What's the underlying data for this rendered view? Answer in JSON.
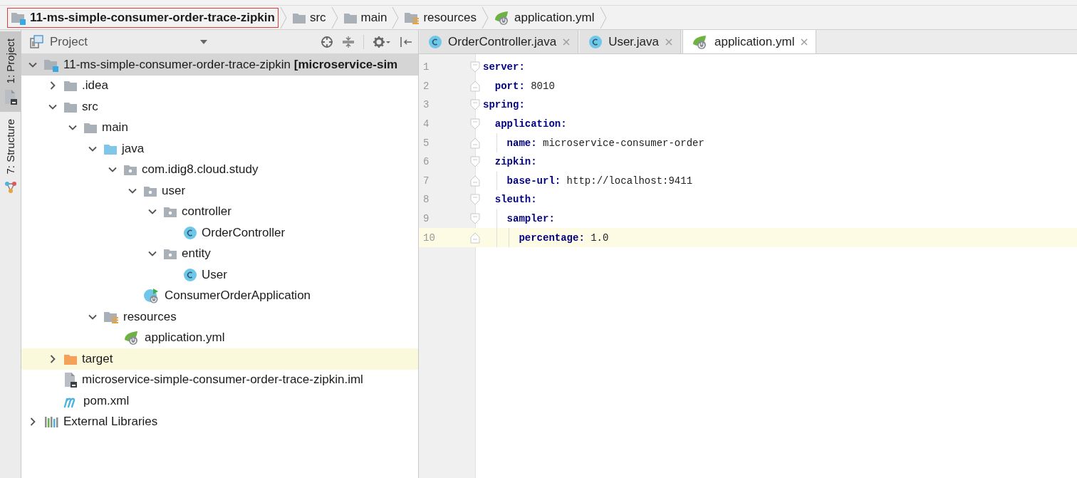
{
  "breadcrumbs": [
    {
      "label": "11-ms-simple-consumer-order-trace-zipkin",
      "kind": "project",
      "outlined": true
    },
    {
      "label": "src",
      "kind": "folder",
      "outlined": false
    },
    {
      "label": "main",
      "kind": "folder",
      "outlined": false
    },
    {
      "label": "resources",
      "kind": "resources",
      "outlined": false
    },
    {
      "label": "application.yml",
      "kind": "yml",
      "outlined": false
    }
  ],
  "tool_stripe": [
    {
      "label": "1: Project",
      "kind": "project",
      "selected": true
    },
    {
      "label": "7: Structure",
      "kind": "structure",
      "selected": false
    }
  ],
  "project_panel": {
    "title": "Project",
    "tree": [
      {
        "label": "11-ms-simple-consumer-order-trace-zipkin **[microservice-sim**",
        "kind": "module",
        "expanded": true,
        "selected": true,
        "highlighted": false,
        "children": [
          {
            "label": ".idea",
            "kind": "folder",
            "expanded": false,
            "selected": false,
            "highlighted": false
          },
          {
            "label": "src",
            "kind": "folder",
            "expanded": true,
            "selected": false,
            "highlighted": false,
            "children": [
              {
                "label": "main",
                "kind": "folder",
                "expanded": true,
                "selected": false,
                "highlighted": false,
                "children": [
                  {
                    "label": "java",
                    "kind": "source",
                    "expanded": true,
                    "selected": false,
                    "highlighted": false,
                    "children": [
                      {
                        "label": "com.idig8.cloud.study",
                        "kind": "package",
                        "expanded": true,
                        "selected": false,
                        "highlighted": false,
                        "children": [
                          {
                            "label": "user",
                            "kind": "package",
                            "expanded": true,
                            "selected": false,
                            "highlighted": false,
                            "children": [
                              {
                                "label": "controller",
                                "kind": "package",
                                "expanded": true,
                                "selected": false,
                                "highlighted": false,
                                "children": [
                                  {
                                    "label": "OrderController",
                                    "kind": "class",
                                    "selected": false,
                                    "highlighted": false
                                  }
                                ]
                              },
                              {
                                "label": "entity",
                                "kind": "package",
                                "expanded": true,
                                "selected": false,
                                "highlighted": false,
                                "children": [
                                  {
                                    "label": "User",
                                    "kind": "class",
                                    "selected": false,
                                    "highlighted": false
                                  }
                                ]
                              }
                            ]
                          },
                          {
                            "label": "ConsumerOrderApplication",
                            "kind": "app",
                            "selected": false,
                            "highlighted": false
                          }
                        ]
                      }
                    ]
                  },
                  {
                    "label": "resources",
                    "kind": "resources",
                    "expanded": true,
                    "selected": false,
                    "highlighted": false,
                    "children": [
                      {
                        "label": "application.yml",
                        "kind": "yml",
                        "selected": false,
                        "highlighted": false
                      }
                    ]
                  }
                ]
              }
            ]
          },
          {
            "label": "target",
            "kind": "excluded",
            "expanded": false,
            "selected": false,
            "highlighted": true
          },
          {
            "label": "microservice-simple-consumer-order-trace-zipkin.iml",
            "kind": "iml",
            "selected": false,
            "highlighted": false
          },
          {
            "label": "pom.xml",
            "kind": "maven",
            "selected": false,
            "highlighted": false
          }
        ]
      },
      {
        "label": "External Libraries",
        "kind": "libraries",
        "expanded": false,
        "selected": false,
        "highlighted": false
      }
    ]
  },
  "editor": {
    "tabs": [
      {
        "label": "OrderController.java",
        "kind": "class",
        "selected": false
      },
      {
        "label": "User.java",
        "kind": "class",
        "selected": false
      },
      {
        "label": "application.yml",
        "kind": "yml",
        "selected": true
      }
    ],
    "lines": [
      {
        "number": "1",
        "key": "server:",
        "current": false,
        "children": [
          {
            "number": "2",
            "key": "port:",
            "value": "8010",
            "current": false
          }
        ]
      },
      {
        "number": "3",
        "key": "spring:",
        "current": false,
        "children": [
          {
            "number": "4",
            "key": "application:",
            "current": false,
            "children": [
              {
                "number": "5",
                "key": "name:",
                "value": "microservice-consumer-order",
                "current": false
              }
            ]
          },
          {
            "number": "6",
            "key": "zipkin:",
            "current": false,
            "children": [
              {
                "number": "7",
                "key": "base-url:",
                "value": "http://localhost:9411",
                "current": false
              }
            ]
          },
          {
            "number": "8",
            "key": "sleuth:",
            "current": false,
            "children": [
              {
                "number": "9",
                "key": "sampler:",
                "current": false,
                "children": [
                  {
                    "number": "10",
                    "key": "percentage:",
                    "value": "1.0",
                    "current": true
                  }
                ]
              }
            ]
          }
        ]
      }
    ]
  }
}
